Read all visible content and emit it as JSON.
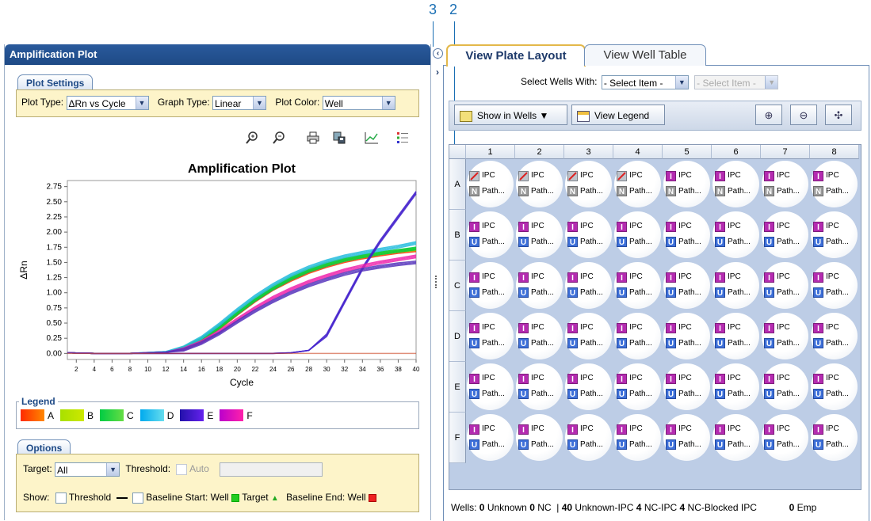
{
  "callouts": {
    "c3": "3",
    "c2": "2"
  },
  "left_panel": {
    "title": "Amplification Plot",
    "plot_settings": {
      "group_label": "Plot Settings",
      "plot_type_label": "Plot Type:",
      "plot_type_value": "ΔRn vs Cycle",
      "graph_type_label": "Graph Type:",
      "graph_type_value": "Linear",
      "plot_color_label": "Plot Color:",
      "plot_color_value": "Well"
    },
    "toolbar_icons": [
      "zoom-in-icon",
      "zoom-out-icon",
      "print-icon",
      "save-image-icon",
      "chart-options-icon",
      "legend-list-icon"
    ]
  },
  "chart_data": {
    "type": "line",
    "title": "Amplification Plot",
    "xlabel": "Cycle",
    "ylabel": "ΔRn",
    "x_ticks": [
      "2",
      "4",
      "6",
      "8",
      "10",
      "12",
      "14",
      "16",
      "18",
      "20",
      "22",
      "24",
      "26",
      "28",
      "30",
      "32",
      "34",
      "36",
      "38",
      "40"
    ],
    "y_ticks": [
      "0.00",
      "0.25",
      "0.50",
      "0.75",
      "1.00",
      "1.25",
      "1.50",
      "1.75",
      "2.00",
      "2.25",
      "2.50",
      "2.75"
    ],
    "xlim": [
      1,
      40
    ],
    "ylim": [
      -0.1,
      2.85
    ],
    "x": [
      1,
      4,
      8,
      12,
      14,
      16,
      18,
      20,
      22,
      24,
      26,
      28,
      30,
      32,
      34,
      36,
      38,
      40
    ],
    "series": [
      {
        "color": "#ff3300",
        "values": [
          0.01,
          0.0,
          0.0,
          0.02,
          0.08,
          0.22,
          0.42,
          0.65,
          0.87,
          1.06,
          1.21,
          1.34,
          1.44,
          1.52,
          1.58,
          1.63,
          1.67,
          1.7
        ]
      },
      {
        "color": "#99dd00",
        "values": [
          0.01,
          0.0,
          0.0,
          0.02,
          0.09,
          0.24,
          0.45,
          0.68,
          0.9,
          1.09,
          1.25,
          1.38,
          1.48,
          1.55,
          1.6,
          1.65,
          1.69,
          1.72
        ]
      },
      {
        "color": "#00cc44",
        "values": [
          0.01,
          0.0,
          0.0,
          0.02,
          0.08,
          0.23,
          0.43,
          0.66,
          0.88,
          1.07,
          1.23,
          1.36,
          1.46,
          1.54,
          1.6,
          1.65,
          1.69,
          1.73
        ]
      },
      {
        "color": "#22bbdd",
        "values": [
          0.01,
          0.0,
          0.0,
          0.03,
          0.1,
          0.26,
          0.48,
          0.72,
          0.94,
          1.13,
          1.29,
          1.42,
          1.52,
          1.6,
          1.66,
          1.71,
          1.76,
          1.82
        ]
      },
      {
        "color": "#4422cc",
        "values": [
          0.01,
          0.0,
          0.0,
          0.0,
          0.0,
          0.0,
          0.0,
          0.0,
          0.0,
          0.0,
          0.01,
          0.05,
          0.3,
          0.85,
          1.4,
          1.85,
          2.25,
          2.65
        ]
      },
      {
        "color": "#ee22aa",
        "values": [
          0.01,
          0.0,
          0.0,
          0.02,
          0.07,
          0.19,
          0.36,
          0.56,
          0.75,
          0.92,
          1.06,
          1.18,
          1.28,
          1.37,
          1.44,
          1.5,
          1.55,
          1.6
        ]
      },
      {
        "color": "#5533bb",
        "values": [
          0.01,
          0.0,
          0.0,
          0.02,
          0.06,
          0.17,
          0.33,
          0.52,
          0.7,
          0.86,
          1.0,
          1.12,
          1.22,
          1.31,
          1.38,
          1.43,
          1.47,
          1.5
        ]
      }
    ]
  },
  "legend": {
    "title": "Legend",
    "items": [
      {
        "label": "A",
        "from": "#ff2a00",
        "to": "#ff8800"
      },
      {
        "label": "B",
        "from": "#a8e000",
        "to": "#cde800"
      },
      {
        "label": "C",
        "from": "#00cc44",
        "to": "#66dd44"
      },
      {
        "label": "D",
        "from": "#00aaee",
        "to": "#66ddee"
      },
      {
        "label": "E",
        "from": "#2211aa",
        "to": "#6622ee"
      },
      {
        "label": "F",
        "from": "#bb00cc",
        "to": "#ff22aa"
      }
    ]
  },
  "options": {
    "group_label": "Options",
    "target_label": "Target:",
    "target_value": "All",
    "threshold_label": "Threshold:",
    "auto_label": "Auto",
    "show_label": "Show:",
    "threshold_check_label": "Threshold",
    "baseline_start_label": "Baseline Start: Well",
    "target_marker_label": "Target",
    "baseline_end_label": "Baseline End: Well"
  },
  "right_panel": {
    "tabs": [
      {
        "label": "View Plate Layout",
        "active": true
      },
      {
        "label": "View Well Table",
        "active": false
      }
    ],
    "select_wells_label": "Select Wells With:",
    "select_item_1": "- Select Item -",
    "select_item_2": "- Select Item -",
    "show_in_wells": "Show in Wells ▼",
    "view_legend": "View Legend",
    "columns": [
      "1",
      "2",
      "3",
      "4",
      "5",
      "6",
      "7",
      "8"
    ],
    "rows": [
      "A",
      "B",
      "C",
      "D",
      "E",
      "F"
    ],
    "well_line1": "IPC",
    "well_line2": "Path...",
    "status": {
      "wells_label": "Wells:",
      "unknown_count": "0",
      "unknown_label": "Unknown",
      "nc_count": "0",
      "nc_label": "NC",
      "sep": "|",
      "unk_ipc_count": "40",
      "unk_ipc_label": "Unknown-IPC",
      "nc_ipc_count": "4",
      "nc_ipc_label": "NC-IPC",
      "nc_blocked_count": "4",
      "nc_blocked_label": "NC-Blocked IPC",
      "empty_count": "0",
      "empty_label": "Emp"
    }
  }
}
